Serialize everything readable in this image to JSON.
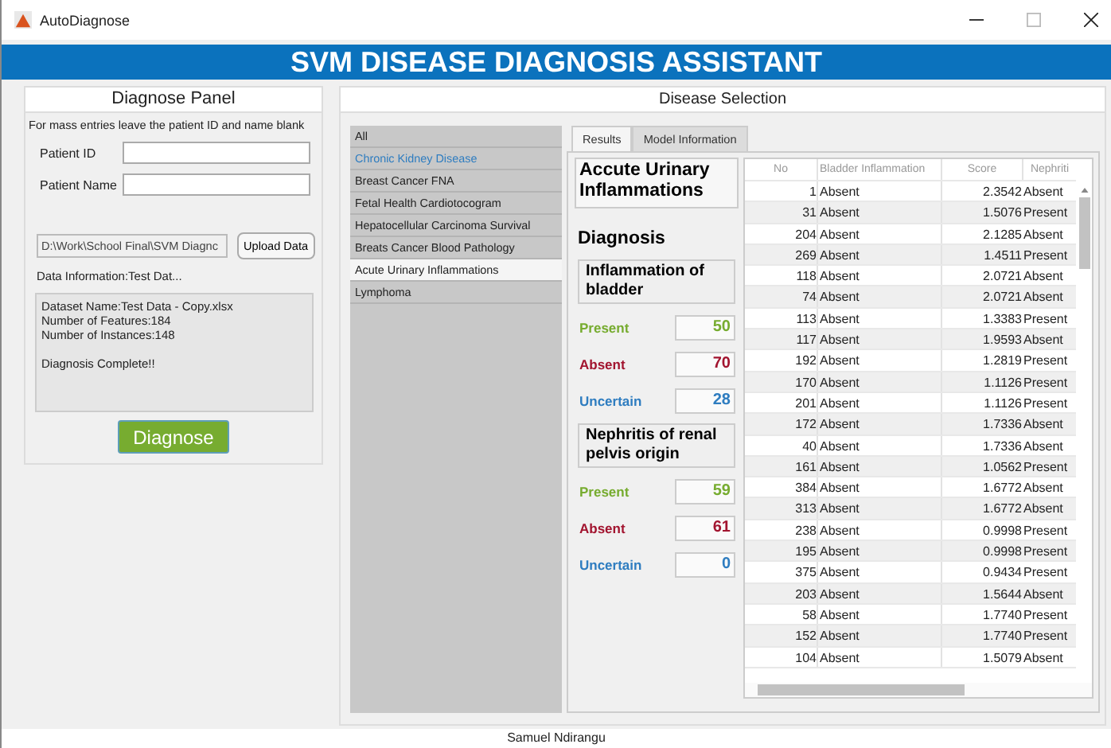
{
  "window": {
    "title": "AutoDiagnose"
  },
  "banner": "SVM DISEASE DIAGNOSIS ASSISTANT",
  "diagnose_panel": {
    "title": "Diagnose Panel",
    "hint": "For mass entries leave the patient ID and name blank",
    "fields": [
      {
        "label": "Patient ID"
      },
      {
        "label": "Patient Name"
      }
    ],
    "file_path": "D:\\Work\\School Final\\SVM Diagnc",
    "upload_button": "Upload Data",
    "data_information": "Data Information:Test Dat...",
    "log": [
      [
        "Dataset Name:Test Data - Copy.xlsx",
        "Number of Features:184",
        "Number of Instances:148"
      ],
      [
        "Diagnosis Complete!!"
      ]
    ],
    "diagnose_button": "Diagnose"
  },
  "disease_selection": {
    "title": "Disease Selection",
    "diseases": [
      {
        "label": "All",
        "selected": false,
        "highlighted": false
      },
      {
        "label": "Chronic Kidney Disease",
        "selected": false,
        "highlighted": true
      },
      {
        "label": "Breast Cancer FNA",
        "selected": false,
        "highlighted": false
      },
      {
        "label": "Fetal Health Cardiotocogram",
        "selected": false,
        "highlighted": false
      },
      {
        "label": "Hepatocellular Carcinoma Survival",
        "selected": false,
        "highlighted": false
      },
      {
        "label": "Breats Cancer Blood Pathology",
        "selected": false,
        "highlighted": false
      },
      {
        "label": "Acute Urinary Inflammations",
        "selected": true,
        "highlighted": false
      },
      {
        "label": "Lymphoma",
        "selected": false,
        "highlighted": false
      }
    ],
    "tabs": [
      {
        "label": "Results",
        "selected": true
      },
      {
        "label": "Model Information",
        "selected": false
      }
    ],
    "results": {
      "disease_title": "Accute Urinary Inflammations",
      "diagnosis_heading": "Diagnosis",
      "groups": [
        {
          "title": "Inflammation of bladder",
          "counts": [
            {
              "kind": "present",
              "label": "Present",
              "value": "50"
            },
            {
              "kind": "absent",
              "label": "Absent",
              "value": "70"
            },
            {
              "kind": "uncertain",
              "label": "Uncertain",
              "value": "28"
            }
          ]
        },
        {
          "title": "Nephritis of renal pelvis origin",
          "counts": [
            {
              "kind": "present",
              "label": "Present",
              "value": "59"
            },
            {
              "kind": "absent",
              "label": "Absent",
              "value": "61"
            },
            {
              "kind": "uncertain",
              "label": "Uncertain",
              "value": "0"
            }
          ]
        }
      ],
      "table": {
        "columns": [
          "No",
          "Bladder Inflammation",
          "Score",
          "Nephriti"
        ],
        "rows": [
          [
            "1",
            "Absent",
            "2.3542",
            "Absent"
          ],
          [
            "31",
            "Absent",
            "1.5076",
            "Present"
          ],
          [
            "204",
            "Absent",
            "2.1285",
            "Absent"
          ],
          [
            "269",
            "Absent",
            "1.4511",
            "Present"
          ],
          [
            "118",
            "Absent",
            "2.0721",
            "Absent"
          ],
          [
            "74",
            "Absent",
            "2.0721",
            "Absent"
          ],
          [
            "113",
            "Absent",
            "1.3383",
            "Present"
          ],
          [
            "117",
            "Absent",
            "1.9593",
            "Absent"
          ],
          [
            "192",
            "Absent",
            "1.2819",
            "Present"
          ],
          [
            "170",
            "Absent",
            "1.1126",
            "Present"
          ],
          [
            "201",
            "Absent",
            "1.1126",
            "Present"
          ],
          [
            "172",
            "Absent",
            "1.7336",
            "Absent"
          ],
          [
            "40",
            "Absent",
            "1.7336",
            "Absent"
          ],
          [
            "161",
            "Absent",
            "1.0562",
            "Present"
          ],
          [
            "384",
            "Absent",
            "1.6772",
            "Absent"
          ],
          [
            "313",
            "Absent",
            "1.6772",
            "Absent"
          ],
          [
            "238",
            "Absent",
            "0.9998",
            "Present"
          ],
          [
            "195",
            "Absent",
            "0.9998",
            "Present"
          ],
          [
            "375",
            "Absent",
            "0.9434",
            "Present"
          ],
          [
            "203",
            "Absent",
            "1.5644",
            "Absent"
          ],
          [
            "58",
            "Absent",
            "1.7740",
            "Present"
          ],
          [
            "152",
            "Absent",
            "1.7740",
            "Present"
          ],
          [
            "104",
            "Absent",
            "1.5079",
            "Absent"
          ]
        ]
      }
    }
  },
  "footer": "Samuel Ndirangu"
}
